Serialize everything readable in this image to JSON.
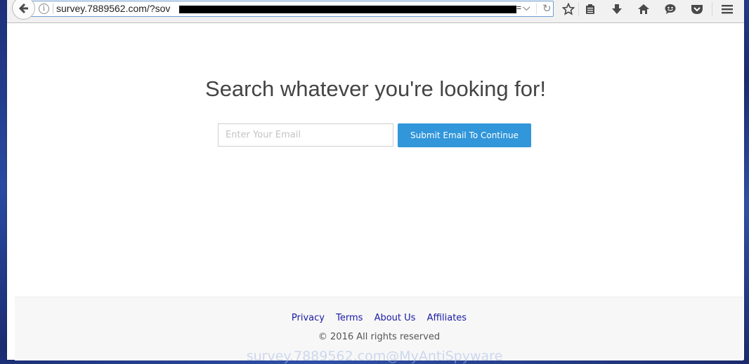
{
  "browser": {
    "url_visible": "survey.7889562.com/?sov",
    "url_tail": "=",
    "toolbar_icons": [
      "bookmark-star-icon",
      "reading-list-icon",
      "downloads-icon",
      "home-icon",
      "chat-icon",
      "pocket-icon",
      "menu-icon"
    ]
  },
  "page": {
    "headline": "Search whatever you're looking for!",
    "email_placeholder": "Enter Your Email",
    "email_value": "",
    "submit_label": "Submit Email To Continue",
    "accent_color": "#3196da"
  },
  "footer": {
    "links": [
      "Privacy",
      "Terms",
      "About Us",
      "Affiliates"
    ],
    "copyright": "© 2016 All rights reserved",
    "link_color": "#1a1aa6"
  },
  "watermark": "survey.7889562.com@MyAntiSpyware"
}
